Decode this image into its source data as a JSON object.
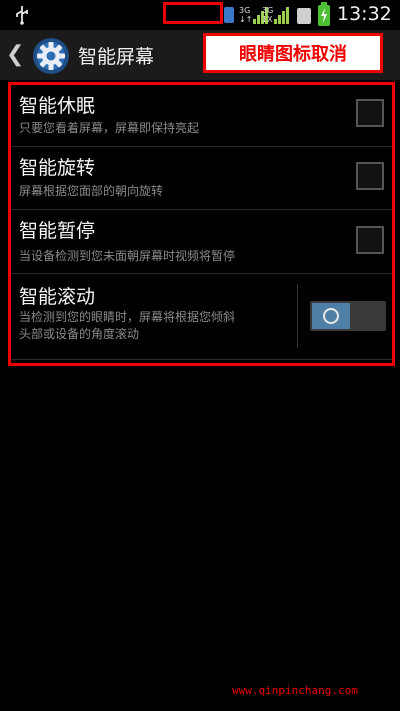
{
  "status_bar": {
    "time": "13:32",
    "network": [
      {
        "type": "3G",
        "sub": "↓↑"
      },
      {
        "type": "3G",
        "sub": "1X"
      }
    ],
    "icons": [
      "usb-icon",
      "sim-icon",
      "battery-charging-icon"
    ]
  },
  "header": {
    "back_icon": "chevron-left-icon",
    "settings_icon": "gear-icon",
    "title": "智能屏幕"
  },
  "annotation": "眼睛图标取消",
  "settings": [
    {
      "title": "智能休眠",
      "desc": "只要您看着屏幕，屏幕即保持亮起",
      "control": "checkbox",
      "checked": false
    },
    {
      "title": "智能旋转",
      "desc": "屏幕根据您面部的朝向旋转",
      "control": "checkbox",
      "checked": false
    },
    {
      "title": "智能暂停",
      "desc": "当设备检测到您未面朝屏幕时视频将暂停",
      "control": "checkbox",
      "checked": false
    },
    {
      "title": "智能滚动",
      "desc_lines": [
        "当检测到您的眼睛时，屏幕将根据您倾斜",
        "头部或设备的角度滚动"
      ],
      "control": "toggle",
      "on": false
    }
  ],
  "watermark": "www.qinpinchang.com",
  "colors": {
    "annotation_red": "#ee0000",
    "toggle_blue": "#4f7fa6",
    "battery_green": "#4cbf35"
  }
}
